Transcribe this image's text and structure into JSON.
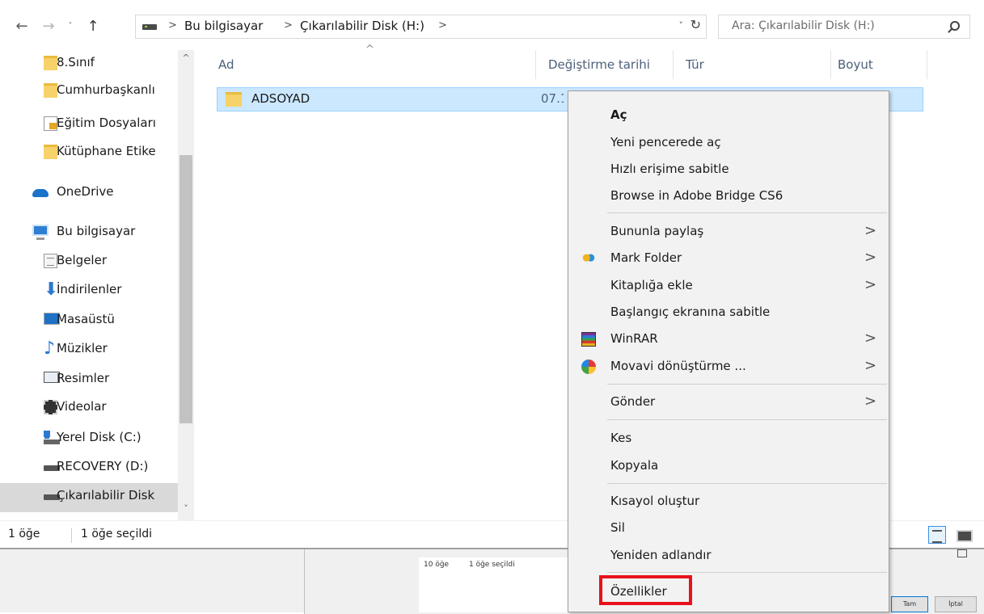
{
  "address": {
    "crumbs": [
      "Bu bilgisayar",
      "Çıkarılabilir Disk (H:)"
    ],
    "separator": ">"
  },
  "search": {
    "placeholder": "Ara: Çıkarılabilir Disk (H:)"
  },
  "icons": {
    "back": "←",
    "forward": "→",
    "recent": "˅",
    "up": "↑",
    "dropdown": "˅",
    "refresh": "↻",
    "chevron": ">",
    "scroll_up": "^",
    "scroll_down": "˅",
    "sort_up": "^",
    "download_arrow": "⬇",
    "music_note": "♪"
  },
  "navpane": {
    "items": [
      {
        "label": "8.Sınıf"
      },
      {
        "label": "Cumhurbaşkanlı"
      },
      {
        "label": "Eğitim Dosyaları"
      },
      {
        "label": "Kütüphane Etike"
      },
      {
        "label": "OneDrive"
      },
      {
        "label": "Bu bilgisayar"
      },
      {
        "label": "Belgeler"
      },
      {
        "label": "İndirilenler"
      },
      {
        "label": "Masaüstü"
      },
      {
        "label": "Müzikler"
      },
      {
        "label": "Resimler"
      },
      {
        "label": "Videolar"
      },
      {
        "label": "Yerel Disk (C:)"
      },
      {
        "label": "RECOVERY (D:)"
      },
      {
        "label": "Çıkarılabilir Disk"
      }
    ]
  },
  "columns": [
    "Ad",
    "Değiştirme tarihi",
    "Tür",
    "Boyut"
  ],
  "files": [
    {
      "name": "ADSOYAD",
      "date": "07.1"
    }
  ],
  "status": {
    "count": "1 öğe",
    "selected": "1 öğe seçildi"
  },
  "background_window": {
    "count": "10 öğe",
    "selected": "1 öğe seçildi",
    "button1": "Tam",
    "button2": "İptal"
  },
  "context_menu": {
    "items": [
      {
        "label": "Aç"
      },
      {
        "label": "Yeni pencerede aç"
      },
      {
        "label": "Hızlı erişime sabitle"
      },
      {
        "label": "Browse in Adobe Bridge CS6"
      },
      {
        "label": "Bununla paylaş"
      },
      {
        "label": "Mark Folder"
      },
      {
        "label": "Kitaplığa ekle"
      },
      {
        "label": "Başlangıç ekranına sabitle"
      },
      {
        "label": "WinRAR"
      },
      {
        "label": "Movavi dönüştürme ..."
      },
      {
        "label": "Gönder"
      },
      {
        "label": "Kes"
      },
      {
        "label": "Kopyala"
      },
      {
        "label": "Kısayol oluştur"
      },
      {
        "label": "Sil"
      },
      {
        "label": "Yeniden adlandır"
      },
      {
        "label": "Özellikler"
      }
    ],
    "highlight_color": "#e8111b"
  }
}
